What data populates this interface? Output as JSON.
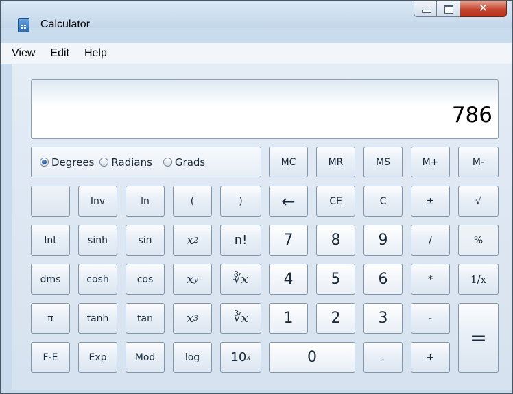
{
  "window": {
    "title": "Calculator",
    "icon": "calculator-icon"
  },
  "menu": [
    "View",
    "Edit",
    "Help"
  ],
  "display": {
    "value": "786"
  },
  "angle_units": {
    "options": [
      "Degrees",
      "Radians",
      "Grads"
    ],
    "selected": "Degrees"
  },
  "memory": {
    "mc": "MC",
    "mr": "MR",
    "ms": "MS",
    "mplus": "M+",
    "mminus": "M-"
  },
  "keys": {
    "inv": "Inv",
    "ln": "ln",
    "lparen": "(",
    "rparen": ")",
    "backspace": "←",
    "ce": "CE",
    "c": "C",
    "plusminus": "±",
    "sqrt": "√",
    "int": "Int",
    "sinh": "sinh",
    "sin": "sin",
    "x_base": "x",
    "sq_exp": "2",
    "fact": "n!",
    "n7": "7",
    "n8": "8",
    "n9": "9",
    "divide": "/",
    "percent": "%",
    "dms": "dms",
    "cosh": "cosh",
    "cos": "cos",
    "pow_exp": "y",
    "yroot": "∛x",
    "yroot_label": "y",
    "n4": "4",
    "n5": "5",
    "n6": "6",
    "multiply": "*",
    "recip": "1/x",
    "pi": "π",
    "tanh": "tanh",
    "tan": "tan",
    "cube_exp": "3",
    "cuberoot": "∛x",
    "n1": "1",
    "n2": "2",
    "n3": "3",
    "minus": "-",
    "equals": "=",
    "fe": "F-E",
    "exp": "Exp",
    "mod": "Mod",
    "log": "log",
    "ten_base": "10",
    "ten_exp": "x",
    "n0": "0",
    "dot": ".",
    "plus": "+"
  }
}
